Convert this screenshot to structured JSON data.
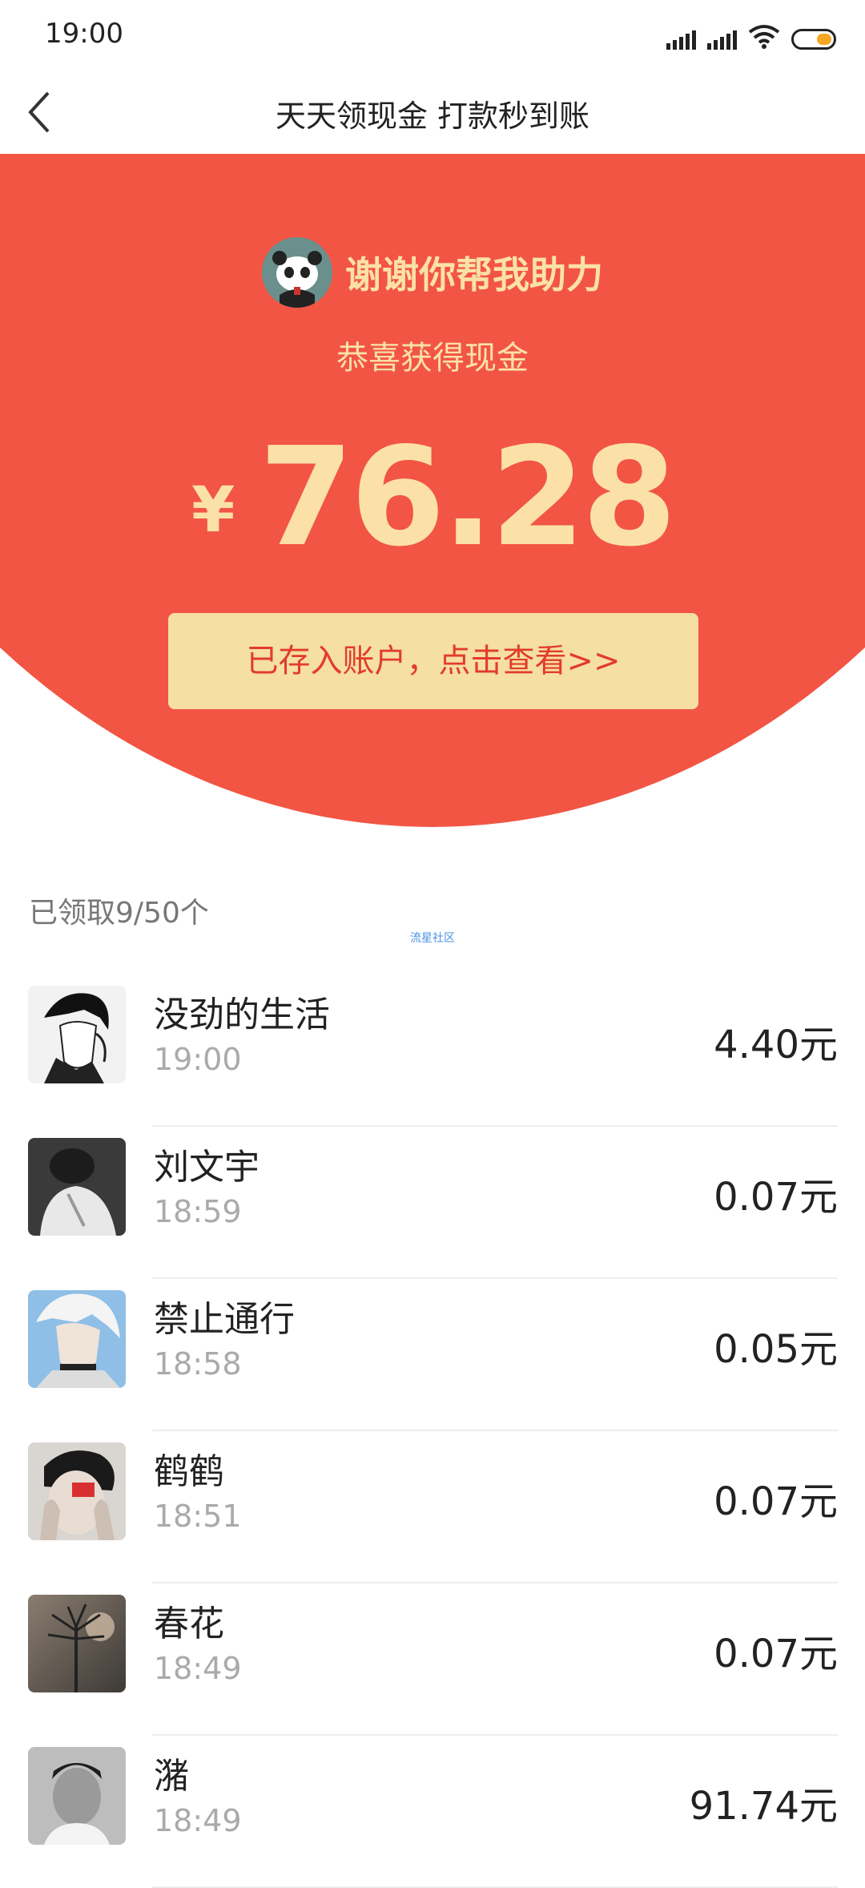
{
  "status_bar": {
    "time": "19:00",
    "battery_color": "#f5a623"
  },
  "nav": {
    "title": "天天领现金 打款秒到账",
    "back_icon": "chevron-left-icon"
  },
  "hero": {
    "owner_name": "谢谢你帮我助力",
    "congrats": "恭喜获得现金",
    "currency": "¥",
    "amount": "76.28",
    "deposit_button": "已存入账户，点击查看>>",
    "colors": {
      "background": "#f25544",
      "accent_text": "#fbe1a8",
      "button_bg": "#f5dfa2",
      "button_text": "#e23c2c"
    }
  },
  "list": {
    "claim_count": "已领取9/50个",
    "watermark": "流星社区",
    "items": [
      {
        "name": "没劲的生活",
        "time": "19:00",
        "amount": "4.40元"
      },
      {
        "name": "刘文宇",
        "time": "18:59",
        "amount": "0.07元"
      },
      {
        "name": "禁止通行",
        "time": "18:58",
        "amount": "0.05元"
      },
      {
        "name": "鹤鹤",
        "time": "18:51",
        "amount": "0.07元"
      },
      {
        "name": "春花",
        "time": "18:49",
        "amount": "0.07元"
      },
      {
        "name": "潴",
        "time": "18:49",
        "amount": "91.74元"
      }
    ]
  }
}
